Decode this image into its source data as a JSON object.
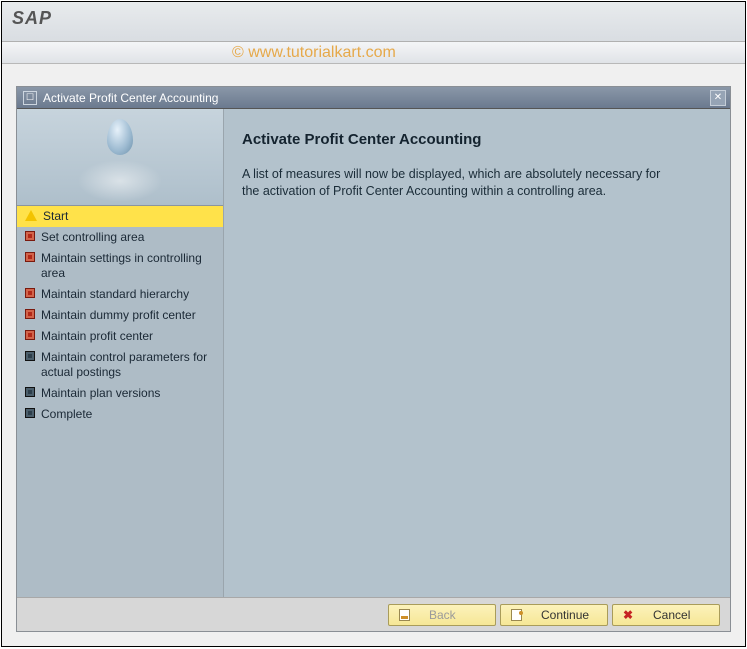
{
  "app_title": "SAP",
  "watermark": "© www.tutorialkart.com",
  "dialog": {
    "title": "Activate Profit Center Accounting",
    "nav": [
      {
        "label": "Start",
        "icon": "warn",
        "selected": true
      },
      {
        "label": "Set controlling area",
        "icon": "square"
      },
      {
        "label": "Maintain settings in controlling area",
        "icon": "square"
      },
      {
        "label": "Maintain standard hierarchy",
        "icon": "square"
      },
      {
        "label": "Maintain dummy profit center",
        "icon": "square"
      },
      {
        "label": "Maintain profit center",
        "icon": "square"
      },
      {
        "label": "Maintain control parameters for actual postings",
        "icon": "dark"
      },
      {
        "label": "Maintain plan versions",
        "icon": "dark"
      },
      {
        "label": "Complete",
        "icon": "dark"
      }
    ],
    "main_title": "Activate Profit Center Accounting",
    "main_text": "A list of measures will now be displayed, which are absolutely necessary for the activation of Profit Center Accounting within a controlling area.",
    "buttons": {
      "back": "Back",
      "continue": "Continue",
      "cancel": "Cancel"
    }
  }
}
